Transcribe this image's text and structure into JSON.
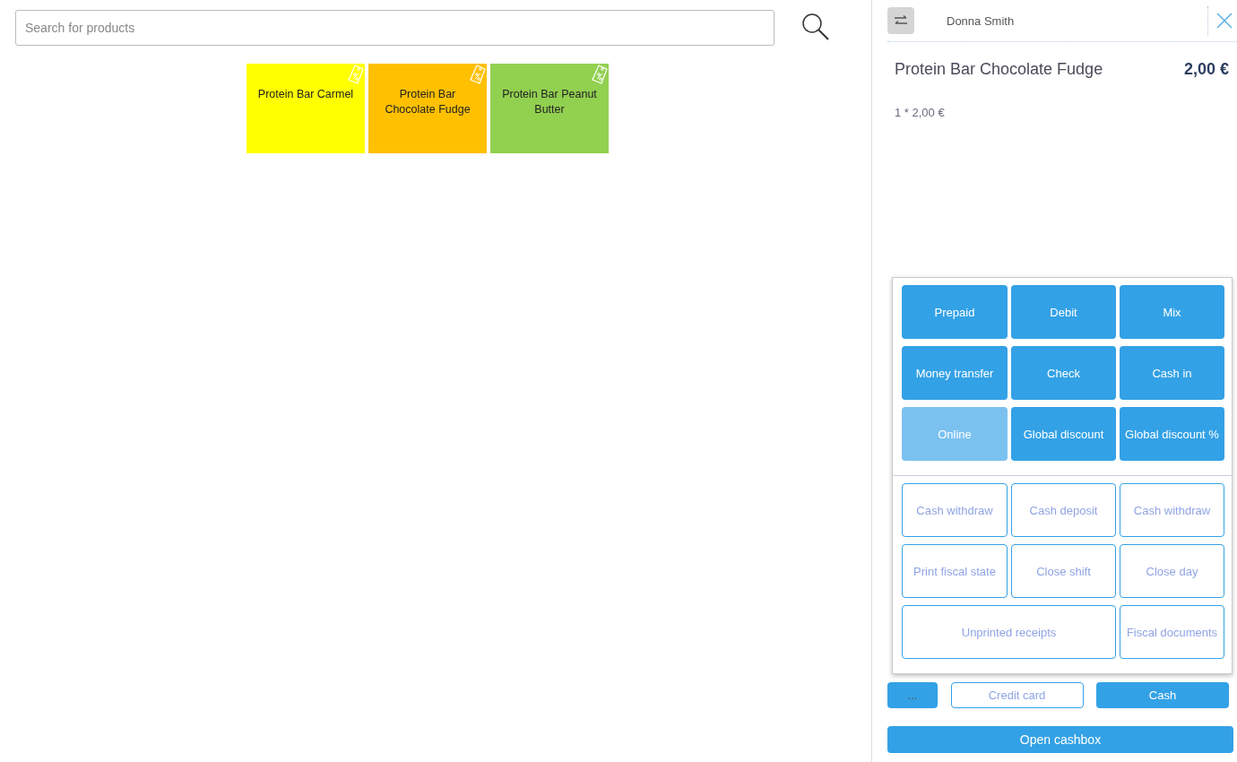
{
  "search": {
    "placeholder": "Search for products"
  },
  "products": [
    {
      "name": "Protein Bar Carmel",
      "color": "#ffff00",
      "discount": true
    },
    {
      "name": "Protein Bar Chocolate Fudge",
      "color": "#ffc000",
      "discount": true
    },
    {
      "name": "Protein Bar Peanut Butter",
      "color": "#92d050",
      "discount": true
    }
  ],
  "customer": {
    "name": "Donna Smith"
  },
  "order_lines": [
    {
      "name": "Protein Bar Chocolate Fudge",
      "total": "2,00 €",
      "detail": "1 * 2,00 €"
    }
  ],
  "payment_menu": {
    "payment_methods": [
      {
        "label": "Prepaid",
        "disabled": false
      },
      {
        "label": "Debit",
        "disabled": false
      },
      {
        "label": "Mix",
        "disabled": false
      },
      {
        "label": "Money transfer",
        "disabled": false
      },
      {
        "label": "Check",
        "disabled": false
      },
      {
        "label": "Cash in",
        "disabled": false
      },
      {
        "label": "Online",
        "disabled": true
      },
      {
        "label": "Global discount",
        "disabled": false
      },
      {
        "label": "Global discount %",
        "disabled": false
      }
    ],
    "operations": [
      {
        "label": "Cash withdraw",
        "wide": false
      },
      {
        "label": "Cash deposit",
        "wide": false
      },
      {
        "label": "Cash withdraw",
        "wide": false
      },
      {
        "label": "Print fiscal state",
        "wide": false
      },
      {
        "label": "Close shift",
        "wide": false
      },
      {
        "label": "Close day",
        "wide": false
      },
      {
        "label": "Unprinted receipts",
        "wide": true
      },
      {
        "label": "Fiscal documents",
        "wide": false
      }
    ]
  },
  "payment_buttons": [
    {
      "label": "...",
      "kind": "more"
    },
    {
      "label": "Credit card",
      "kind": "outline"
    },
    {
      "label": "Cash",
      "kind": "filled"
    }
  ],
  "open_cashbox": {
    "label": "Open cashbox"
  }
}
